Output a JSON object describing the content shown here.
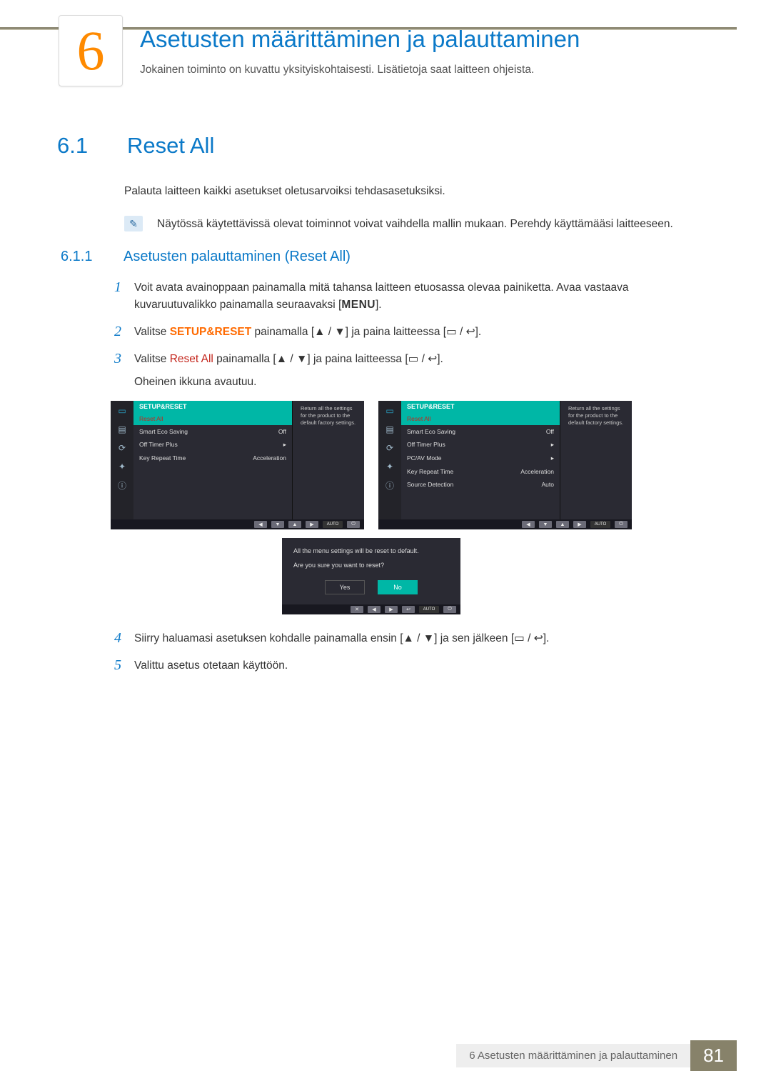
{
  "chapter": {
    "number": "6",
    "title": "Asetusten määrittäminen ja palauttaminen",
    "subtitle": "Jokainen toiminto on kuvattu yksityiskohtaisesti. Lisätietoja saat laitteen ohjeista."
  },
  "section": {
    "number": "6.1",
    "title": "Reset All",
    "intro": "Palauta laitteen kaikki asetukset oletusarvoiksi tehdasasetuksiksi.",
    "note_icon": "✎",
    "note": "Näytössä käytettävissä olevat toiminnot voivat vaihdella mallin mukaan. Perehdy käyttämääsi laitteeseen."
  },
  "subsection": {
    "number": "6.1.1",
    "title": "Asetusten palauttaminen (Reset All)"
  },
  "steps": {
    "s1n": "1",
    "s1a": "Voit avata avainoppaan painamalla mitä tahansa laitteen etuosassa olevaa painiketta. Avaa vastaava kuvaruutuvalikko painamalla seuraavaksi [",
    "s1menu": "MENU",
    "s1b": "].",
    "s2n": "2",
    "s2a": "Valitse ",
    "s2kw": "SETUP&RESET",
    "s2b": " painamalla [",
    "s2arrows": "▲ / ▼",
    "s2c": "] ja paina laitteessa [",
    "s2icons": "▭ / ↩",
    "s2d": "].",
    "s3n": "3",
    "s3a": "Valitse ",
    "s3kw": "Reset All",
    "s3b": " painamalla [",
    "s3arrows": "▲ / ▼",
    "s3c": "] ja paina laitteessa [",
    "s3icons": "▭ / ↩",
    "s3d": "].",
    "s3e": "Oheinen ikkuna avautuu.",
    "s4n": "4",
    "s4a": "Siirry haluamasi asetuksen kohdalle painamalla ensin [",
    "s4arrows": "▲ / ▼",
    "s4b": "] ja sen jälkeen [",
    "s4icons": "▭ / ↩",
    "s4c": "].",
    "s5n": "5",
    "s5": "Valittu asetus otetaan käyttöön."
  },
  "osd": {
    "title": "SETUP&RESET",
    "desc": "Return all the settings for the product to the default factory settings.",
    "left": {
      "reset": {
        "label": "Reset All",
        "value": ""
      },
      "eco": {
        "label": "Smart Eco Saving",
        "value": "Off"
      },
      "timer": {
        "label": "Off Timer Plus",
        "value": "▸"
      },
      "key": {
        "label": "Key Repeat Time",
        "value": "Acceleration"
      }
    },
    "right": {
      "reset": {
        "label": "Reset All",
        "value": ""
      },
      "eco": {
        "label": "Smart Eco Saving",
        "value": "Off"
      },
      "timer": {
        "label": "Off Timer Plus",
        "value": "▸"
      },
      "pcav": {
        "label": "PC/AV Mode",
        "value": "▸"
      },
      "key": {
        "label": "Key Repeat Time",
        "value": "Acceleration"
      },
      "src": {
        "label": "Source Detection",
        "value": "Auto"
      }
    },
    "foot": {
      "left": "◀",
      "down": "▼",
      "up": "▲",
      "right": "▶",
      "auto": "AUTO",
      "power": "⏻"
    }
  },
  "dialog": {
    "line1": "All the menu settings will be reset to default.",
    "line2": "Are you sure you want to reset?",
    "yes": "Yes",
    "no": "No",
    "foot": {
      "x": "✕",
      "left": "◀",
      "right": "▶",
      "enter": "↩",
      "auto": "AUTO",
      "power": "⏻"
    }
  },
  "footer": {
    "text": "6 Asetusten määrittäminen ja palauttaminen",
    "page": "81"
  }
}
